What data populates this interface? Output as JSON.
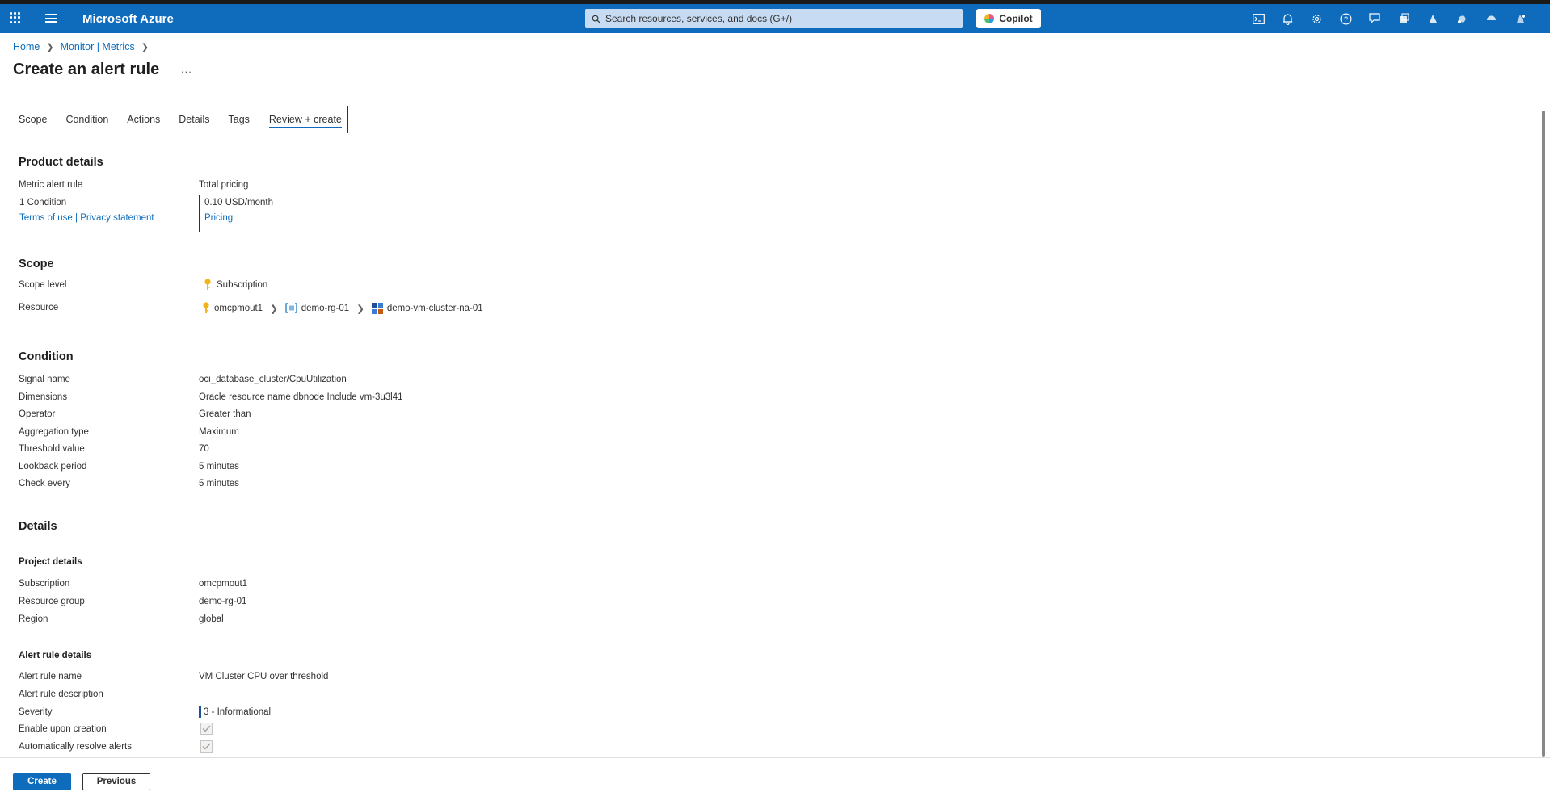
{
  "topbar": {
    "brand": "Microsoft Azure",
    "search_placeholder": "Search resources, services, and docs (G+/)",
    "copilot_label": "Copilot",
    "icons": [
      "cloud-shell-icon",
      "bell-icon",
      "gear-icon",
      "help-icon",
      "feedback-icon",
      "directory-icon",
      "app-icon",
      "app-icon",
      "app-icon",
      "app-icon"
    ]
  },
  "breadcrumb": {
    "home": "Home",
    "monitor": "Monitor | Metrics"
  },
  "page": {
    "title": "Create an alert rule",
    "more": "..."
  },
  "tabs": [
    {
      "label": "Scope"
    },
    {
      "label": "Condition"
    },
    {
      "label": "Actions"
    },
    {
      "label": "Details"
    },
    {
      "label": "Tags"
    },
    {
      "label": "Review + create",
      "active": true
    }
  ],
  "product": {
    "heading": "Product details",
    "rule_label": "Metric alert rule",
    "condition_count": "1 Condition",
    "terms": "Terms of use",
    "separator": "|",
    "privacy": "Privacy statement",
    "pricing_label": "Total pricing",
    "price": "0.10 USD/month",
    "pricing_link": "Pricing"
  },
  "scope": {
    "heading": "Scope",
    "level_label": "Scope level",
    "level_value": "Subscription",
    "resource_label": "Resource",
    "resource_path": [
      "omcpmout1",
      "demo-rg-01",
      "demo-vm-cluster-na-01"
    ]
  },
  "condition": {
    "heading": "Condition",
    "rows": [
      {
        "label": "Signal name",
        "value": "oci_database_cluster/CpuUtilization"
      },
      {
        "label": "Dimensions",
        "value": "Oracle resource name dbnode Include vm-3u3l41"
      },
      {
        "label": "Operator",
        "value": "Greater than"
      },
      {
        "label": "Aggregation type",
        "value": "Maximum"
      },
      {
        "label": "Threshold value",
        "value": "70"
      },
      {
        "label": "Lookback period",
        "value": "5 minutes"
      },
      {
        "label": "Check every",
        "value": "5 minutes"
      }
    ]
  },
  "details": {
    "heading": "Details",
    "project_heading": "Project details",
    "project_rows": [
      {
        "label": "Subscription",
        "value": "omcpmout1"
      },
      {
        "label": "Resource group",
        "value": "demo-rg-01"
      },
      {
        "label": "Region",
        "value": "global"
      }
    ],
    "alert_heading": "Alert rule details",
    "alert_name_label": "Alert rule name",
    "alert_name_value": "VM Cluster CPU over threshold",
    "description_label": "Alert rule description",
    "severity_label": "Severity",
    "severity_value": "3 - Informational",
    "enable_label": "Enable upon creation",
    "enable_checked": true,
    "autoresolve_label": "Automatically resolve alerts",
    "autoresolve_checked": true
  },
  "footer": {
    "create": "Create",
    "previous": "Previous"
  },
  "colors": {
    "accent": "#0f6cbd",
    "topbar": "#0f6cbd",
    "severity_bar": "#1f4e9a"
  }
}
